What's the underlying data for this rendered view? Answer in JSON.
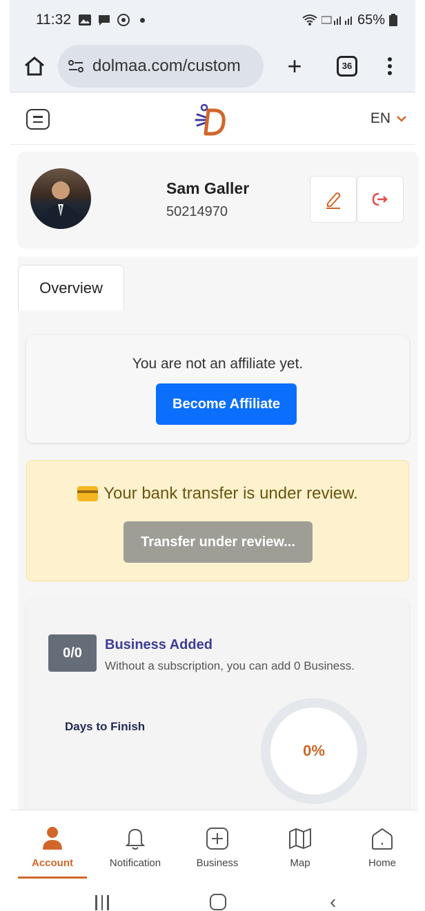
{
  "status_bar": {
    "time": "11:32",
    "battery": "65%"
  },
  "browser": {
    "url": "dolmaa.com/custom",
    "tab_count": "36"
  },
  "header": {
    "language": "EN"
  },
  "profile": {
    "name": "Sam Galler",
    "user_id": "50214970"
  },
  "tabs": [
    {
      "label": "Overview"
    }
  ],
  "affiliate": {
    "message": "You are not an affiliate yet.",
    "button_label": "Become Affiliate",
    "button_color": "#0b6efd"
  },
  "bank_transfer": {
    "message": "Your bank transfer is under review.",
    "button_label": "Transfer under review...",
    "background_color": "#fdf2cd"
  },
  "business": {
    "count": "0/0",
    "title": "Business Added",
    "subtitle": "Without a subscription, you can add 0 Business.",
    "days_label": "Days to Finish",
    "progress": "0%"
  },
  "bottom_nav": {
    "items": [
      {
        "label": "Account",
        "icon": "person-icon",
        "active": true
      },
      {
        "label": "Notification",
        "icon": "bell-icon",
        "active": false
      },
      {
        "label": "Business",
        "icon": "plus-square-icon",
        "active": false
      },
      {
        "label": "Map",
        "icon": "map-icon",
        "active": false
      },
      {
        "label": "Home",
        "icon": "home-icon",
        "active": false
      }
    ],
    "accent_color": "#d2662a"
  }
}
